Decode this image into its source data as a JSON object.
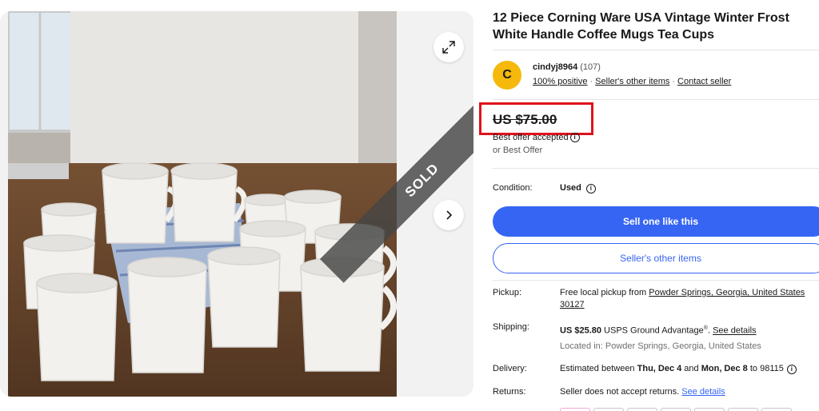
{
  "listing": {
    "title": "12 Piece Corning Ware USA Vintage Winter Frost White Handle Coffee Mugs Tea Cups",
    "sold_label": "SOLD"
  },
  "seller": {
    "avatar_letter": "C",
    "name": "cindyj8964",
    "feedback_count": "(107)",
    "positive": "100% positive",
    "other_items_link": "Seller's other items",
    "contact": "Contact seller"
  },
  "price": {
    "amount": "US $75.00",
    "best_offer_accepted": "Best offer accepted",
    "or_best_offer": "or Best Offer"
  },
  "condition": {
    "label": "Condition:",
    "value": "Used"
  },
  "buttons": {
    "sell_one": "Sell one like this",
    "sellers_other_items": "Seller's other items"
  },
  "pickup": {
    "label": "Pickup:",
    "prefix": "Free local pickup from ",
    "location_link": "Powder Springs, Georgia, United States 30127"
  },
  "shipping": {
    "label": "Shipping:",
    "cost": "US $25.80",
    "service": " USPS Ground Advantage",
    "reg": "®",
    "sep": ". ",
    "details_link": "See details",
    "located_in": "Located in: Powder Springs, Georgia, United States"
  },
  "delivery": {
    "label": "Delivery:",
    "prefix": "Estimated between ",
    "start": "Thu, Dec 4",
    "and": " and ",
    "end": "Mon, Dec 8",
    "suffix": " to 98115"
  },
  "returns": {
    "label": "Returns:",
    "text": "Seller does not accept returns. ",
    "details_link": "See details"
  },
  "colors": {
    "primary_blue": "#3665f3",
    "highlight_red": "#e0121b",
    "avatar_yellow": "#f5b80b"
  },
  "icons": {
    "expand": "expand-icon",
    "next": "chevron-right-icon",
    "info": "info-icon"
  }
}
